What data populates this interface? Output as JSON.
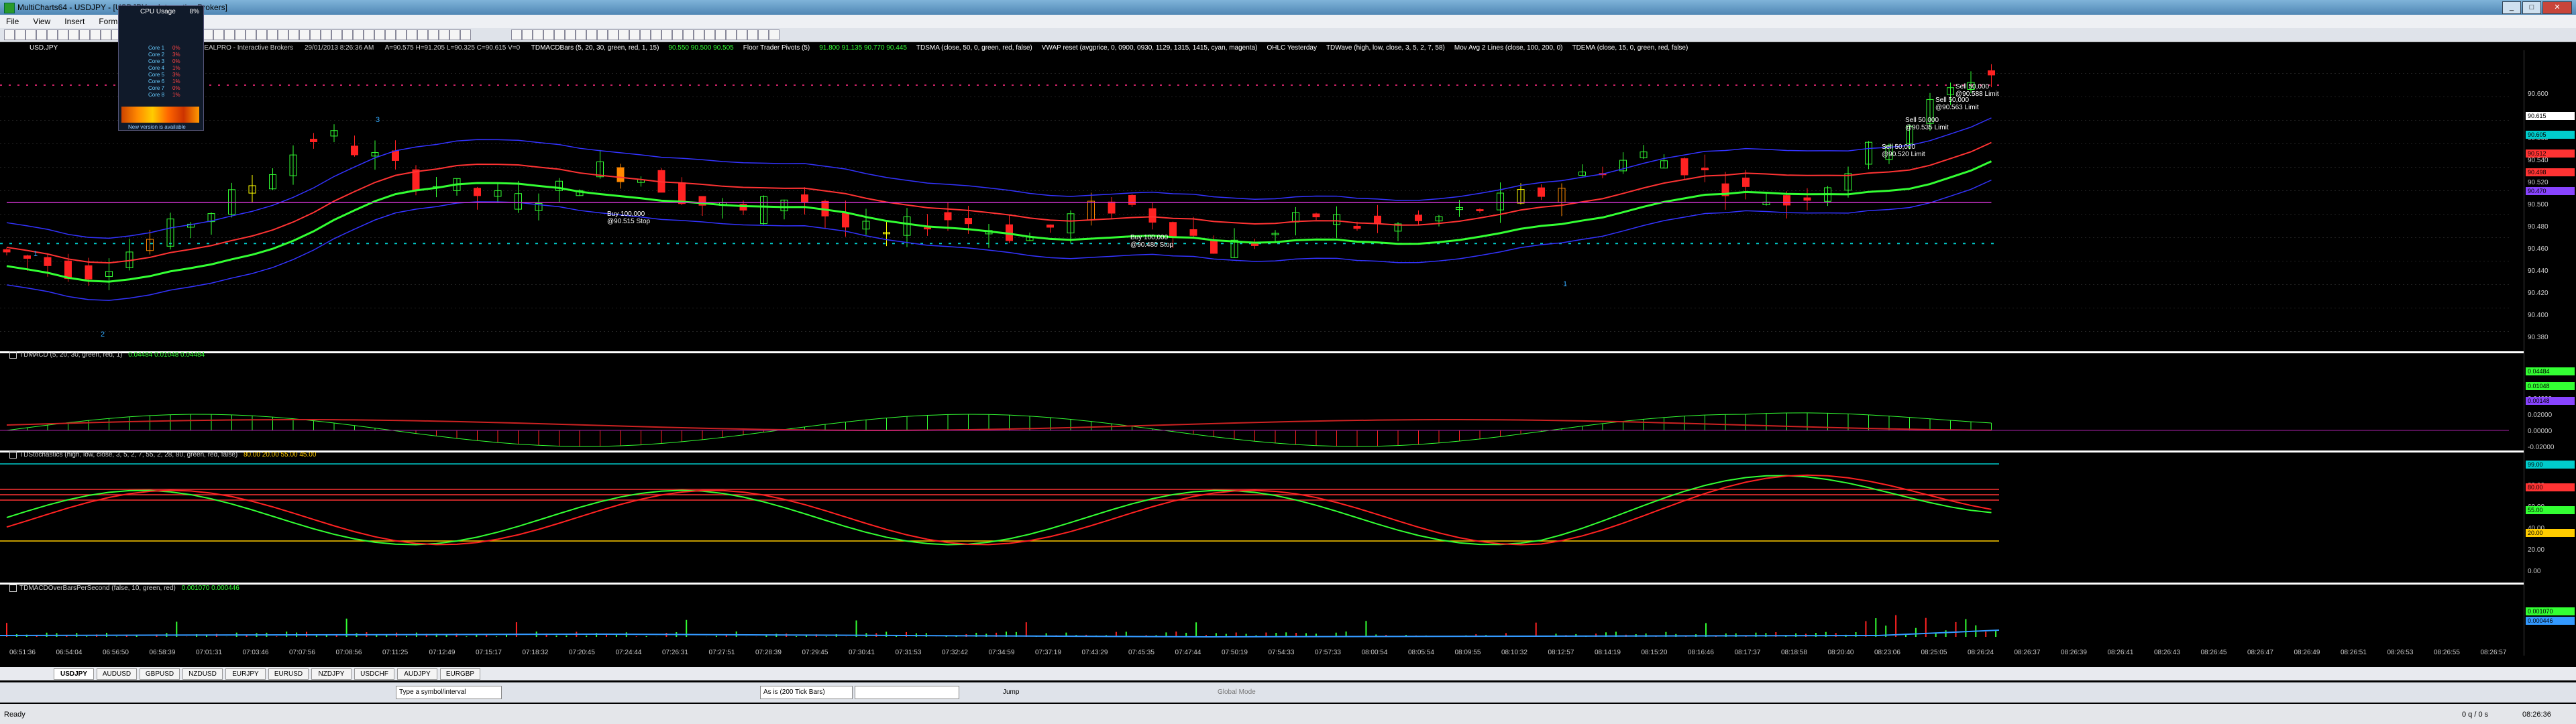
{
  "window": {
    "title": "MultiCharts64 - USDJPY - [USDJPY ... Interactive Brokers]",
    "buttons": [
      "_",
      "□",
      "✕"
    ]
  },
  "menu": [
    "File",
    "View",
    "Insert",
    "Format"
  ],
  "cpu_widget": {
    "title": "CPU Usage",
    "percent": "8%",
    "rows": [
      {
        "label": "Core 1",
        "value": "0%"
      },
      {
        "label": "Core 2",
        "value": "3%"
      },
      {
        "label": "Core 3",
        "value": "0%"
      },
      {
        "label": "Core 4",
        "value": "1%"
      },
      {
        "label": "Core 5",
        "value": "3%"
      },
      {
        "label": "Core 6",
        "value": "1%"
      },
      {
        "label": "Core 7",
        "value": "0%"
      },
      {
        "label": "Core 8",
        "value": "1%"
      }
    ],
    "footer": "New version is available"
  },
  "status": {
    "symbol": "USD.JPY",
    "desc": "Trade: IDEALPRO - Interactive Brokers",
    "datetime": "29/01/2013 8:26:36 AM",
    "ohlc": "A=90.575  H=91.205  L=90.325  C=90.615  V=0",
    "studies": [
      {
        "text": "TDMACDBars (5, 20, 30, green, red, 1, 15)",
        "color": "#ffffff"
      },
      {
        "text": "90.550  90.500  90.505",
        "color": "#33ff33"
      },
      {
        "text": "Floor Trader Pivots (5)",
        "color": "#ffffff"
      },
      {
        "text": "91.800  91.135  90.770  90.445",
        "color": "#33ff33"
      },
      {
        "text": "TDSMA (close, 50, 0, green, red, false)",
        "color": "#ffffff"
      },
      {
        "text": "VWAP reset (avgprice, 0, 0900, 0930, 1129, 1315, 1415, cyan, magenta)",
        "color": "#ffffff"
      },
      {
        "text": "OHLC Yesterday",
        "color": "#ffffff"
      },
      {
        "text": "TDWave (high, low, close, 3, 5, 2, 7, 58)",
        "color": "#ffffff"
      },
      {
        "text": "Mov Avg 2 Lines (close, 100, 200, 0)",
        "color": "#ffffff"
      },
      {
        "text": "TDEMA (close, 15, 0, green, red, false)",
        "color": "#ffffff"
      }
    ]
  },
  "panels": {
    "macd": {
      "title": "TDMACD (5, 20, 30, green, red, 1)",
      "values": "0.04484  0.01048  0.04484"
    },
    "stoch": {
      "title": "TDStochastics (high, low, close, 3, 5, 2, 7, 55, 2, 28, 80, green, red, false)",
      "values": "80.00  20.00  55.00  45.00"
    },
    "overbars": {
      "title": "TDMACDOverBarsPerSecond (false, 10, green, red)",
      "values": "0.001070  0.000446"
    }
  },
  "price_axis": [
    "90.600",
    "90.580",
    "90.560",
    "90.540",
    "90.520",
    "90.500",
    "90.480",
    "90.460",
    "90.440",
    "90.420",
    "90.400",
    "90.380"
  ],
  "price_tags": [
    {
      "text": "90.615",
      "color": "#ffffff"
    },
    {
      "text": "90.605",
      "color": "#00cccc"
    },
    {
      "text": "90.512",
      "color": "#ff3333"
    },
    {
      "text": "90.498",
      "color": "#ff3333"
    },
    {
      "text": "90.470",
      "color": "#8844ff"
    }
  ],
  "macd_axis": [
    "0.04000",
    "0.02000",
    "0.00000",
    "-0.02000"
  ],
  "macd_tags": [
    {
      "text": "0.04484",
      "color": "#33ff33"
    },
    {
      "text": "0.01048",
      "color": "#33ff33"
    },
    {
      "text": "0.00148",
      "color": "#8844ff"
    }
  ],
  "stoch_axis": [
    "100.00",
    "80.00",
    "60.00",
    "40.00",
    "20.00",
    "0.00"
  ],
  "stoch_tags": [
    {
      "text": "99.00",
      "color": "#00cccc"
    },
    {
      "text": "80.00",
      "color": "#ff3333"
    },
    {
      "text": "55.00",
      "color": "#33ff33"
    },
    {
      "text": "20.00",
      "color": "#ffcc00"
    }
  ],
  "over_tags": [
    {
      "text": "0.001070",
      "color": "#33ff33"
    },
    {
      "text": "0.000446",
      "color": "#3399ff"
    }
  ],
  "trade_labels": [
    {
      "text": "Sell 50,000",
      "sub": "@90.588 Limit"
    },
    {
      "text": "Sell 50,000",
      "sub": "@90.563 Limit"
    },
    {
      "text": "Sell 50,000",
      "sub": "@90.535 Limit"
    },
    {
      "text": "Sell 50,000",
      "sub": "@90.520 Limit"
    },
    {
      "text": "Buy 100,000",
      "sub": "@90.515 Stop"
    },
    {
      "text": "Buy 100,000",
      "sub": "@90.480 Stop"
    }
  ],
  "wave_labels": [
    "1",
    "2",
    "3",
    "1"
  ],
  "time_axis": [
    "06:51:36",
    "06:54:04",
    "06:56:50",
    "06:58:39",
    "07:01:31",
    "07:03:46",
    "07:07:56",
    "07:08:56",
    "07:11:25",
    "07:12:49",
    "07:15:17",
    "07:18:32",
    "07:20:45",
    "07:24:44",
    "07:26:31",
    "07:27:51",
    "07:28:39",
    "07:29:45",
    "07:30:41",
    "07:31:53",
    "07:32:42",
    "07:34:59",
    "07:37:19",
    "07:43:29",
    "07:45:35",
    "07:47:44",
    "07:50:19",
    "07:54:33",
    "07:57:33",
    "08:00:54",
    "08:05:54",
    "08:09:55",
    "08:10:32",
    "08:12:57",
    "08:14:19",
    "08:15:20",
    "08:16:46",
    "08:17:37",
    "08:18:58",
    "08:20:40",
    "08:23:06",
    "08:25:05",
    "08:26:24",
    "08:26:37",
    "08:26:39",
    "08:26:41",
    "08:26:43",
    "08:26:45",
    "08:26:47",
    "08:26:49",
    "08:26:51",
    "08:26:53",
    "08:26:55",
    "08:26:57"
  ],
  "symbol_tabs": [
    "USDJPY",
    "AUDUSD",
    "GBPUSD",
    "NZDUSD",
    "EURJPY",
    "EURUSD",
    "NZDJPY",
    "USDCHF",
    "AUDJPY",
    "EURGBP"
  ],
  "bottom": {
    "symbol_placeholder": "Type a symbol/interval",
    "resolution": "As is (200 Tick Bars)",
    "jump": "Jump",
    "global_mode": "Global Mode"
  },
  "statusbar": {
    "ready": "Ready",
    "queue": "0 q / 0 s",
    "clock": "08:26:36"
  },
  "colors": {
    "bull": "#33ff33",
    "bear": "#ff2222",
    "sma": "#33ff33",
    "vwap": "#00cccc",
    "ema": "#ff3333",
    "mavg1": "#3333ff",
    "mavg2": "#cc33cc",
    "accent_yellow": "#ffff00"
  }
}
